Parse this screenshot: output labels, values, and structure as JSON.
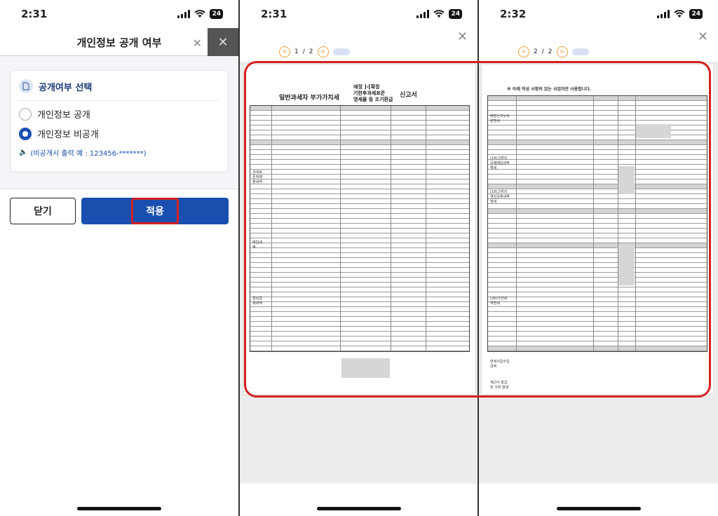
{
  "panel1": {
    "time": "2:31",
    "battery": "24",
    "title": "개인정보 공개 여부",
    "section_title": "공개여부 선택",
    "options": [
      "개인정보 공개",
      "개인정보 비공개"
    ],
    "selected_option": "개인정보 비공개",
    "note": "(비공개시 출력 예 : 123456-*******)",
    "close_button": "닫기",
    "apply_button": "적용",
    "accent_color": "#1a4fb0",
    "highlight_color": "#d42020"
  },
  "panel2": {
    "time": "2:31",
    "battery": "24",
    "page_current": "1",
    "page_separator": "/",
    "page_total": "2",
    "doc": {
      "title": "일반과세자 부가가치세",
      "subtitle_lines": [
        "예정 ]-[확정",
        "기한후과세표준",
        "영세율 등 조기환급"
      ],
      "subtitle_suffix": "신고서",
      "section_labels": [
        "과세표준및매출세액",
        "매입세액",
        "경감공제세액"
      ]
    }
  },
  "panel3": {
    "time": "2:32",
    "battery": "24",
    "page_current": "2",
    "page_separator": "/",
    "page_total": "2",
    "doc": {
      "header": "※ 아래 작성 사항의 있는 사업자만 사용합니다.",
      "section_labels": [
        "예정신고누락분명세",
        "(14)그밖의공제매입세액명세",
        "(18)그밖의경감공제세액명세",
        "(26)가산세액명세",
        "면세사업수입금액",
        "계산서 발급 및 수취 명세"
      ]
    }
  }
}
